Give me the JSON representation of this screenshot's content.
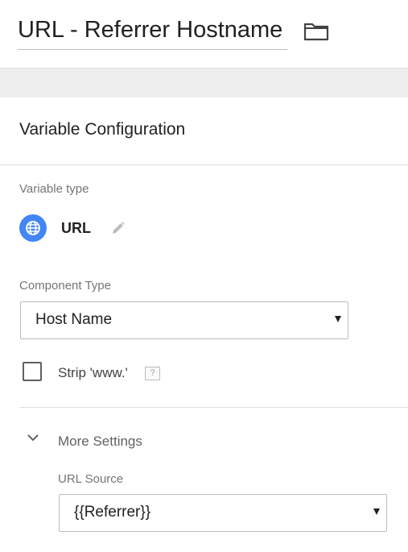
{
  "header": {
    "title": "URL - Referrer Hostname",
    "folder_icon": "folder-icon"
  },
  "config": {
    "section_title": "Variable Configuration",
    "variable_type_label": "Variable type",
    "variable_type": {
      "icon": "globe-icon",
      "icon_color": "#4285f4",
      "name": "URL",
      "edit_icon": "pencil-icon"
    },
    "component_type": {
      "label": "Component Type",
      "selected": "Host Name"
    },
    "strip_www": {
      "label": "Strip 'www.'",
      "checked": false,
      "help": "?"
    }
  },
  "more_settings": {
    "label": "More Settings",
    "expanded": true,
    "url_source": {
      "label": "URL Source",
      "selected": "{{Referrer}}"
    }
  }
}
